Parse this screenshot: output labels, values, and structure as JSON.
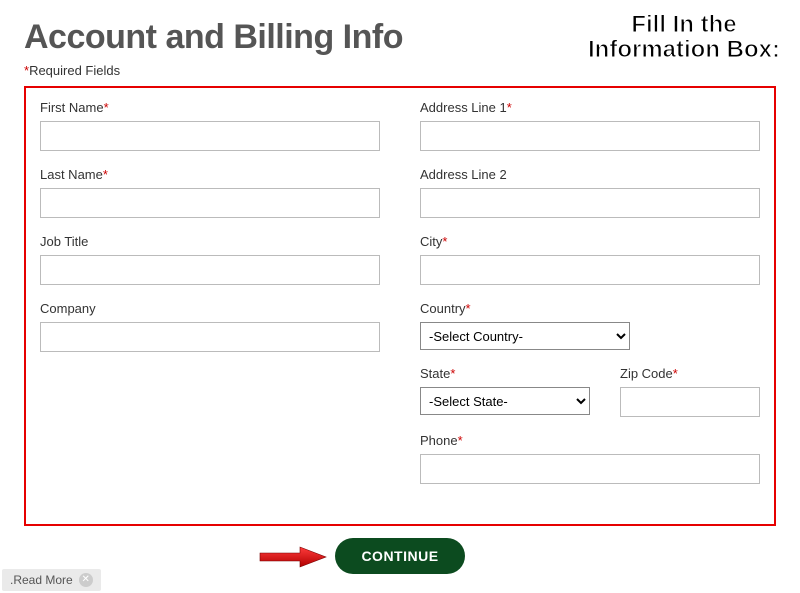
{
  "header": {
    "title": "Account and Billing Info",
    "required_legend_ast": "*",
    "required_legend": "Required Fields"
  },
  "overlay": {
    "line1": "Fill In the",
    "line2": "Information Box:"
  },
  "form": {
    "left": {
      "first_name": {
        "label": "First Name",
        "required": true,
        "value": ""
      },
      "last_name": {
        "label": "Last Name",
        "required": true,
        "value": ""
      },
      "job_title": {
        "label": "Job Title",
        "required": false,
        "value": ""
      },
      "company": {
        "label": "Company",
        "required": false,
        "value": ""
      }
    },
    "right": {
      "address1": {
        "label": "Address Line 1",
        "required": true,
        "value": ""
      },
      "address2": {
        "label": "Address Line 2",
        "required": false,
        "value": ""
      },
      "city": {
        "label": "City",
        "required": true,
        "value": ""
      },
      "country": {
        "label": "Country",
        "required": true,
        "selected": "-Select Country-"
      },
      "state": {
        "label": "State",
        "required": true,
        "selected": "-Select State-"
      },
      "zip": {
        "label": "Zip Code",
        "required": true,
        "value": ""
      },
      "phone": {
        "label": "Phone",
        "required": true,
        "value": ""
      }
    }
  },
  "buttons": {
    "continue": "CONTINUE"
  },
  "footer": {
    "read_more_prefix": ". ",
    "read_more": "Read More"
  },
  "ast": "*"
}
